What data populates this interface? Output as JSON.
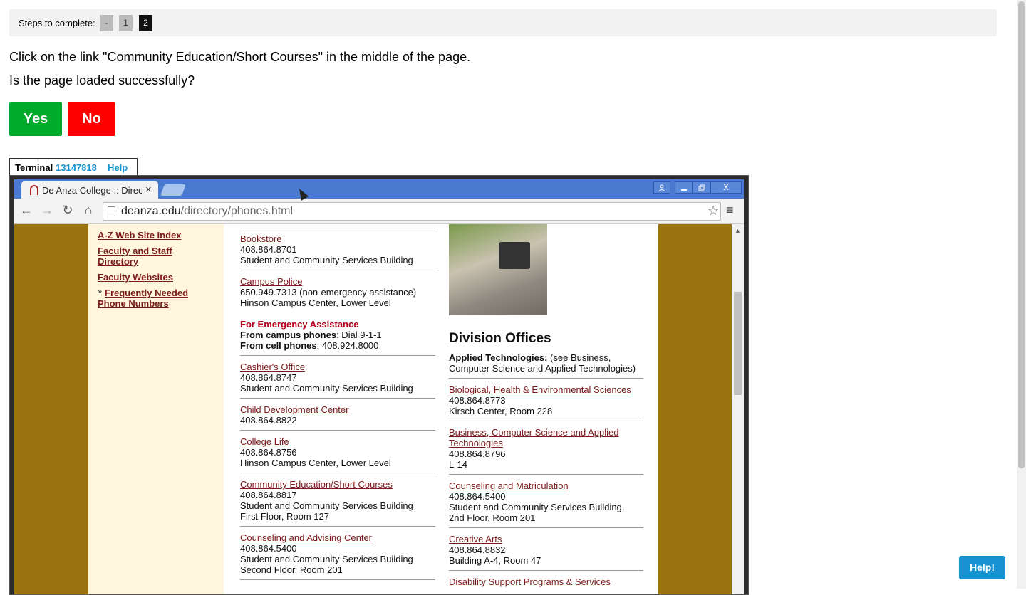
{
  "steps": {
    "label": "Steps to complete:",
    "items": [
      "-",
      "1",
      "2"
    ]
  },
  "instruction": "Click on the link \"Community Education/Short Courses\" in the middle of the page.",
  "question": "Is the page loaded successfully?",
  "buttons": {
    "yes": "Yes",
    "no": "No"
  },
  "terminal": {
    "label": "Terminal",
    "id": "13147818",
    "help": "Help"
  },
  "browser": {
    "tab_title": "De Anza College :: Directo",
    "tab_close": "×",
    "url_domain": "deanza.edu",
    "url_path": "/directory/phones.html",
    "icons": {
      "back": "←",
      "forward": "→",
      "reload": "↻",
      "home": "⌂",
      "star": "☆",
      "menu": "≡",
      "user": "👤",
      "min": "—",
      "max": "❐",
      "close": "X"
    }
  },
  "left_nav": [
    "A-Z Web Site Index",
    "Faculty and Staff Directory",
    "Faculty Websites",
    "Frequently Needed Phone Numbers"
  ],
  "col1": {
    "bookstore": {
      "link": "Bookstore",
      "phone": "408.864.8701",
      "loc": "Student and Community Services Building"
    },
    "police": {
      "link": "Campus Police",
      "phone": "650.949.7313 (non-emergency assistance)",
      "loc": "Hinson Campus Center, Lower Level"
    },
    "emergency": {
      "title": "For Emergency Assistance",
      "campus_label": "From campus phones",
      "campus_value": ": Dial 9-1-1",
      "cell_label": "From cell phones",
      "cell_value": ": 408.924.8000"
    },
    "cashier": {
      "link": "Cashier's Office",
      "phone": "408.864.8747",
      "loc": "Student and Community Services Building"
    },
    "child": {
      "link": "Child Development Center",
      "phone": "408.864.8822"
    },
    "life": {
      "link": "College Life",
      "phone": "408.864.8756",
      "loc": "Hinson Campus Center, Lower Level"
    },
    "community": {
      "link": "Community Education/Short Courses",
      "phone": "408.864.8817",
      "loc": "Student and Community Services Building",
      "loc2": "First Floor, Room 127"
    },
    "counseling": {
      "link": "Counseling and Advising Center",
      "phone": "408.864.5400",
      "loc": "Student and Community Services Building",
      "loc2": "Second Floor, Room 201"
    }
  },
  "col2": {
    "title": "Division Offices",
    "applied": {
      "label": "Applied Technologies:",
      "text": " (see Business, Computer Science and Applied Technologies)"
    },
    "bio": {
      "link": "Biological, Health & Environmental Sciences",
      "phone": "408.864.8773",
      "loc": "Kirsch Center, Room 228"
    },
    "business": {
      "link": "Business, Computer Science and Applied Technologies",
      "phone": "408.864.8796",
      "loc": "L-14"
    },
    "counsel": {
      "link": "Counseling and Matriculation",
      "phone": "408.864.5400",
      "loc": "Student and Community Services Building,",
      "loc2": "2nd Floor, Room 201"
    },
    "arts": {
      "link": "Creative Arts",
      "phone": "408.864.8832",
      "loc": "Building A-4, Room 47"
    },
    "dsps": {
      "link": "Disability Support Programs & Services"
    }
  },
  "help_button": "Help!"
}
